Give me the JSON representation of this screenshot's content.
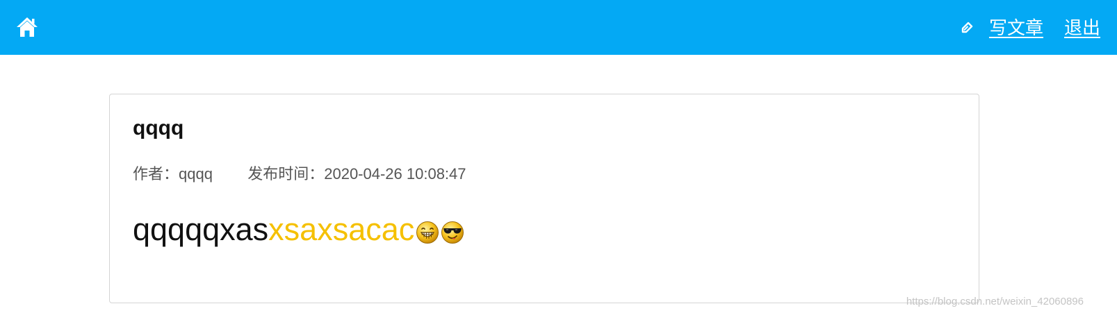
{
  "header": {
    "home_icon": "home-icon",
    "pen_icon": "edit-icon",
    "write_label": "写文章",
    "logout_label": "退出",
    "background_color": "#04a9f4"
  },
  "post": {
    "title": "qqqq",
    "author_label": "作者：",
    "author": "qqqq",
    "published_label": "发布时间：",
    "published_at": "2020-04-26 10:08:47",
    "content_plain": "qqqqqxas",
    "content_highlight": "xsaxsacac",
    "highlight_color": "#f5c000",
    "emojis": [
      "grinning-emoji-icon",
      "sunglasses-emoji-icon"
    ]
  },
  "watermark": "https://blog.csdn.net/weixin_42060896"
}
